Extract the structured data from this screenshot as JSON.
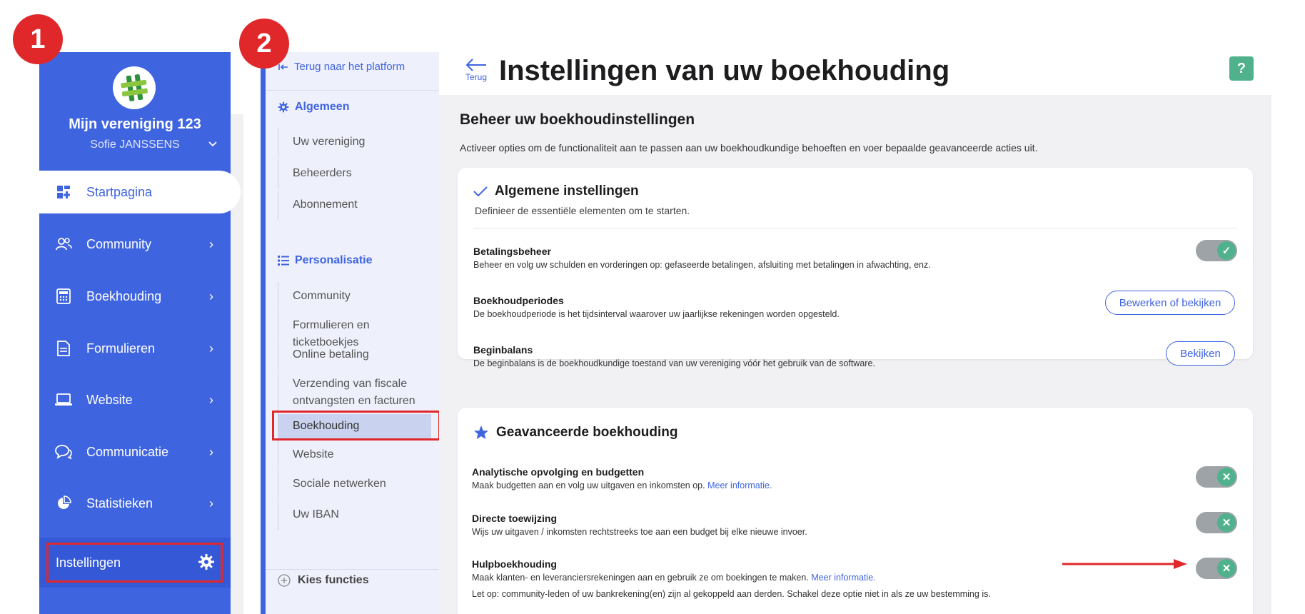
{
  "steps": {
    "one": "1",
    "two": "2"
  },
  "sidebar": {
    "org_name": "Mijn vereniging 123",
    "user_name": "Sofie JANSSENS",
    "items": [
      {
        "label": "Startpagina",
        "icon": "dashboard-icon",
        "active": true
      },
      {
        "label": "Community",
        "icon": "users-icon"
      },
      {
        "label": "Boekhouding",
        "icon": "calculator-icon"
      },
      {
        "label": "Formulieren",
        "icon": "document-icon"
      },
      {
        "label": "Website",
        "icon": "laptop-icon"
      },
      {
        "label": "Communicatie",
        "icon": "chat-icon"
      },
      {
        "label": "Statistieken",
        "icon": "pie-chart-icon"
      }
    ],
    "settings_label": "Instellingen"
  },
  "menu": {
    "back_label": "Terug naar het platform",
    "general_heading": "Algemeen",
    "general_items": [
      "Uw vereniging",
      "Beheerders",
      "Abonnement"
    ],
    "custom_heading": "Personalisatie",
    "custom_items": [
      "Community",
      "Formulieren en ticketboekjes",
      "Online betaling",
      "Verzending van fiscale ontvangsten en facturen",
      "Boekhouding",
      "Website",
      "Sociale netwerken",
      "Uw IBAN"
    ],
    "active_item": "Boekhouding",
    "bottom_label": "Kies functies"
  },
  "header": {
    "back_label": "Terug",
    "title": "Instellingen van uw boekhouding",
    "help_label": "?"
  },
  "main": {
    "section_title": "Beheer uw boekhoudinstellingen",
    "section_desc": "Activeer opties om de functionaliteit aan te passen aan uw boekhoudkundige behoeften en voer bepaalde geavanceerde acties uit.",
    "general": {
      "title": "Algemene instellingen",
      "subtitle": "Definieer de essentiële elementen om te starten.",
      "rows": [
        {
          "title": "Betalingsbeheer",
          "desc": "Beheer en volg uw schulden en vorderingen op: gefaseerde betalingen, afsluiting met betalingen in afwachting, enz.",
          "toggle_on": true
        },
        {
          "title": "Boekhoudperiodes",
          "desc": "De boekhoudperiode is het tijdsinterval waarover uw jaarlijkse rekeningen worden opgesteld.",
          "button": "Bewerken of bekijken"
        },
        {
          "title": "Beginbalans",
          "desc": "De beginbalans is de boekhoudkundige toestand van uw vereniging vóór het gebruik van de software.",
          "button": "Bekijken"
        }
      ]
    },
    "advanced": {
      "title": "Geavanceerde boekhouding",
      "rows": [
        {
          "title": "Analytische opvolging en budgetten",
          "desc": "Maak budgetten aan en volg uw uitgaven en inkomsten op.",
          "link": "Meer informatie.",
          "toggle_on": false
        },
        {
          "title": "Directe toewijzing",
          "desc": "Wijs uw uitgaven / inkomsten rechtstreeks toe aan een budget bij elke nieuwe invoer.",
          "toggle_on": false
        },
        {
          "title": "Hulpboekhouding",
          "desc": "Maak klanten- en leveranciersrekeningen aan en gebruik ze om boekingen te maken.",
          "link": "Meer informatie.",
          "desc2": "Let op: community-leden of uw bankrekening(en) zijn al gekoppeld aan derden. Schakel deze optie niet in als ze uw bestemming is.",
          "toggle_on": false
        }
      ]
    }
  },
  "colors": {
    "primary": "#3f64e0",
    "accent_green": "#4fb28c",
    "marker_red": "#e0282b"
  }
}
